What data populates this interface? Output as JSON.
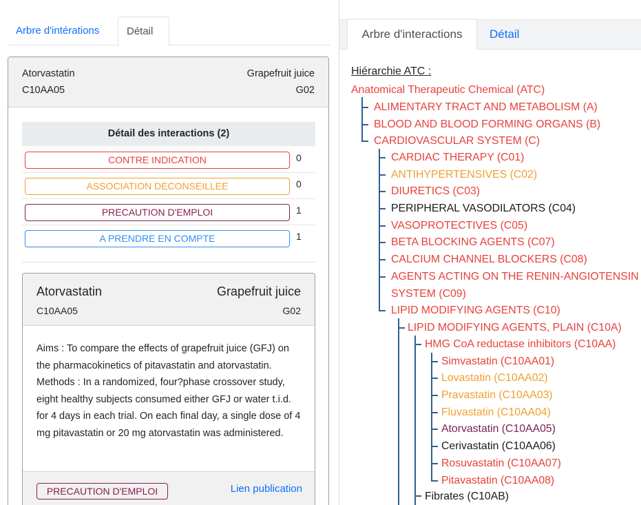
{
  "left": {
    "tabs": [
      {
        "label": "Arbre d'intérations",
        "active": false
      },
      {
        "label": "Détail",
        "active": true
      }
    ],
    "card": {
      "drug1": "Atorvastatin",
      "code1": "C10AA05",
      "drug2": "Grapefruit juice",
      "code2": "G02",
      "interactions_title": "Détail des interactions (2)",
      "interactions": [
        {
          "label": "CONTRE INDICATION",
          "count": "0",
          "color": "#e8413a"
        },
        {
          "label": "ASSOCIATION DECONSEILLEE",
          "count": "0",
          "color": "#f0a030"
        },
        {
          "label": "PRECAUTION D'EMPLOI",
          "count": "1",
          "color": "#8a1e4c"
        },
        {
          "label": "A PRENDRE EN COMPTE",
          "count": "1",
          "color": "#2f8ff0"
        }
      ],
      "detail": {
        "drug1": "Atorvastatin",
        "code1": "C10AA05",
        "drug2": "Grapefruit juice",
        "code2": "G02",
        "abstract": "Aims : To compare the effects of grapefruit juice (GFJ) on the pharmacokinetics of pitavastatin and atorvastatin. Methods : In a randomized, four?phase crossover study, eight healthy subjects consumed either GFJ or water t.i.d. for 4 days in each trial. On each final day, a single dose of 4 mg pitavastatin or 20 mg atorvastatin was administered.",
        "badge": "PRECAUTION D'EMPLOI",
        "link": "Lien publication"
      }
    }
  },
  "right": {
    "tabs": [
      {
        "label": "Arbre d'interactions",
        "active": true
      },
      {
        "label": "Détail",
        "active": false
      }
    ],
    "hierarchy_title": "Hiérarchie ATC :",
    "nodes": [
      {
        "text": "Anatomical Therapeutic Chemical (ATC)",
        "color": "red"
      },
      {
        "text": "ALIMENTARY TRACT AND METABOLISM (A)",
        "color": "red"
      },
      {
        "text": "BLOOD AND BLOOD FORMING ORGANS (B)",
        "color": "red"
      },
      {
        "text": "CARDIOVASCULAR SYSTEM (C)",
        "color": "red"
      },
      {
        "text": "CARDIAC THERAPY (C01)",
        "color": "red"
      },
      {
        "text": "ANTIHYPERTENSIVES (C02)",
        "color": "orange"
      },
      {
        "text": "DIURETICS (C03)",
        "color": "red"
      },
      {
        "text": "PERIPHERAL VASODILATORS (C04)",
        "color": "black"
      },
      {
        "text": "VASOPROTECTIVES (C05)",
        "color": "red"
      },
      {
        "text": "BETA BLOCKING AGENTS (C07)",
        "color": "red"
      },
      {
        "text": "CALCIUM CHANNEL BLOCKERS (C08)",
        "color": "red"
      },
      {
        "text": "AGENTS ACTING ON THE RENIN-ANGIOTENSIN",
        "color": "red"
      },
      {
        "text": "SYSTEM (C09)",
        "color": "red"
      },
      {
        "text": "LIPID MODIFYING AGENTS (C10)",
        "color": "red"
      },
      {
        "text": "LIPID MODIFYING AGENTS, PLAIN (C10A)",
        "color": "red"
      },
      {
        "text": "HMG CoA reductase inhibitors (C10AA)",
        "color": "red"
      },
      {
        "text": "Simvastatin (C10AA01)",
        "color": "red"
      },
      {
        "text": "Lovastatin (C10AA02)",
        "color": "orange"
      },
      {
        "text": "Pravastatin (C10AA03)",
        "color": "orange"
      },
      {
        "text": "Fluvastatin (C10AA04)",
        "color": "orange"
      },
      {
        "text": "Atorvastatin (C10AA05)",
        "color": "purple"
      },
      {
        "text": "Cerivastatin (C10AA06)",
        "color": "black"
      },
      {
        "text": "Rosuvastatin (C10AA07)",
        "color": "red"
      },
      {
        "text": "Pitavastatin (C10AA08)",
        "color": "red"
      },
      {
        "text": "Fibrates (C10AB)",
        "color": "black"
      }
    ]
  }
}
